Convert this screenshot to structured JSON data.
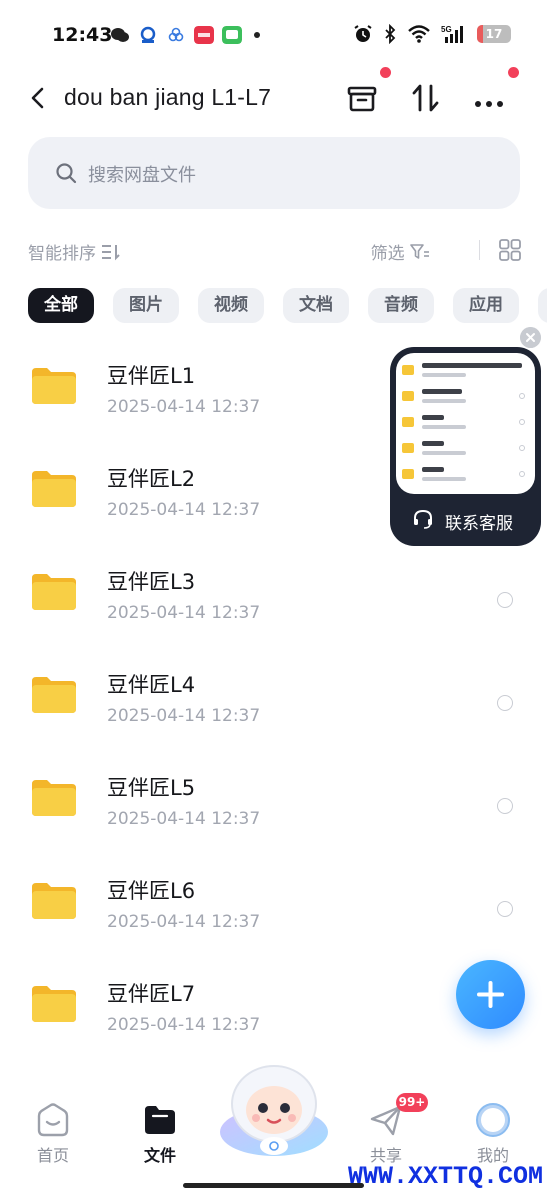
{
  "status_bar": {
    "time": "12:43",
    "battery": "17",
    "network": "5G"
  },
  "header": {
    "title": "dou  ban  jiang L1-L7"
  },
  "search": {
    "placeholder": "搜索网盘文件"
  },
  "toolbar": {
    "sort_label": "智能排序",
    "filter_label": "筛选"
  },
  "chips": [
    {
      "label": "全部",
      "active": true
    },
    {
      "label": "图片",
      "active": false
    },
    {
      "label": "视频",
      "active": false
    },
    {
      "label": "文档",
      "active": false
    },
    {
      "label": "音频",
      "active": false
    },
    {
      "label": "应用",
      "active": false
    }
  ],
  "files": [
    {
      "name": "豆伴匠L1",
      "date": "2025-04-14  12:37"
    },
    {
      "name": "豆伴匠L2",
      "date": "2025-04-14  12:37"
    },
    {
      "name": "豆伴匠L3",
      "date": "2025-04-14  12:37"
    },
    {
      "name": "豆伴匠L4",
      "date": "2025-04-14  12:37"
    },
    {
      "name": "豆伴匠L5",
      "date": "2025-04-14  12:37"
    },
    {
      "name": "豆伴匠L6",
      "date": "2025-04-14  12:37"
    },
    {
      "name": "豆伴匠L7",
      "date": "2025-04-14  12:37"
    }
  ],
  "customer_service": {
    "label": "联系客服"
  },
  "bottom_nav": {
    "items": [
      {
        "label": "首页",
        "icon": "home-icon"
      },
      {
        "label": "文件",
        "icon": "folder-icon"
      },
      {
        "label": "共享",
        "icon": "send-icon"
      },
      {
        "label": "我的",
        "icon": "profile-icon"
      }
    ],
    "share_badge": "99+"
  },
  "watermark": "WWW.XXTTQ.COM",
  "colors": {
    "accent": "#2f8bff",
    "folder": "#f6c638",
    "badge": "#f2405a"
  }
}
